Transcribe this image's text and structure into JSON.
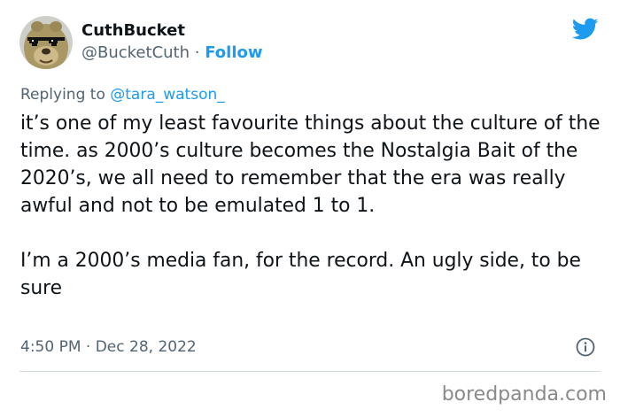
{
  "tweet": {
    "display_name": "CuthBucket",
    "handle": "@BucketCuth",
    "separator": "·",
    "follow_label": "Follow",
    "replying_prefix": "Replying to",
    "replying_to": "@tara_watson_",
    "paragraphs": [
      "it’s one of my least favourite things about the culture of the time. as 2000’s culture becomes the Nostalgia Bait of the 2020’s, we all need to remember that the era was really awful and not to be emulated 1 to 1.",
      "I’m a 2000’s media fan, for the record. An ugly side, to be sure"
    ],
    "time": "4:50 PM",
    "date": "Dec 28, 2022",
    "brand_color": "#1d9bf0"
  },
  "icons": {
    "brand": "twitter-bird-icon",
    "info": "info-icon",
    "avatar": "avatar-character-with-sunglasses"
  },
  "watermark": {
    "text": "boredpanda.com"
  }
}
